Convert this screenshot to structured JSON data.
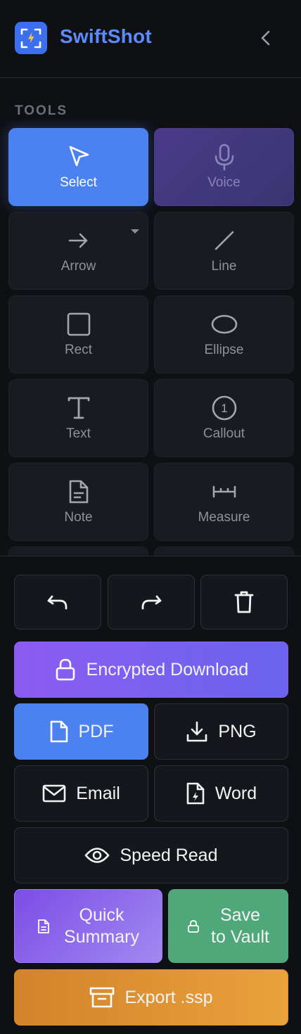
{
  "app": {
    "title": "SwiftShot"
  },
  "tools": {
    "section_label": "TOOLS",
    "items": [
      {
        "id": "select",
        "label": "Select",
        "icon": "cursor-icon"
      },
      {
        "id": "voice",
        "label": "Voice",
        "icon": "microphone-icon"
      },
      {
        "id": "arrow",
        "label": "Arrow",
        "icon": "arrow-right-icon"
      },
      {
        "id": "line",
        "label": "Line",
        "icon": "line-icon"
      },
      {
        "id": "rect",
        "label": "Rect",
        "icon": "square-icon"
      },
      {
        "id": "ellipse",
        "label": "Ellipse",
        "icon": "ellipse-icon"
      },
      {
        "id": "text",
        "label": "Text",
        "icon": "text-icon"
      },
      {
        "id": "callout",
        "label": "Callout",
        "icon": "numbered-circle-icon",
        "badge": "1"
      },
      {
        "id": "note",
        "label": "Note",
        "icon": "document-icon"
      },
      {
        "id": "measure",
        "label": "Measure",
        "icon": "ruler-icon"
      }
    ]
  },
  "actions": {
    "encrypted_download": "Encrypted Download",
    "pdf": "PDF",
    "png": "PNG",
    "email": "Email",
    "word": "Word",
    "speed_read": "Speed Read",
    "quick_summary_line1": "Quick",
    "quick_summary_line2": "Summary",
    "save_vault_line1": "Save",
    "save_vault_line2": "to Vault",
    "export": "Export .ssp"
  },
  "colors": {
    "accent": "#4b82f0",
    "brand": "#5b8cff",
    "background": "#0f1014",
    "purple": "#8b5cf0",
    "green": "#4fa87a",
    "orange": "#e09a36"
  }
}
